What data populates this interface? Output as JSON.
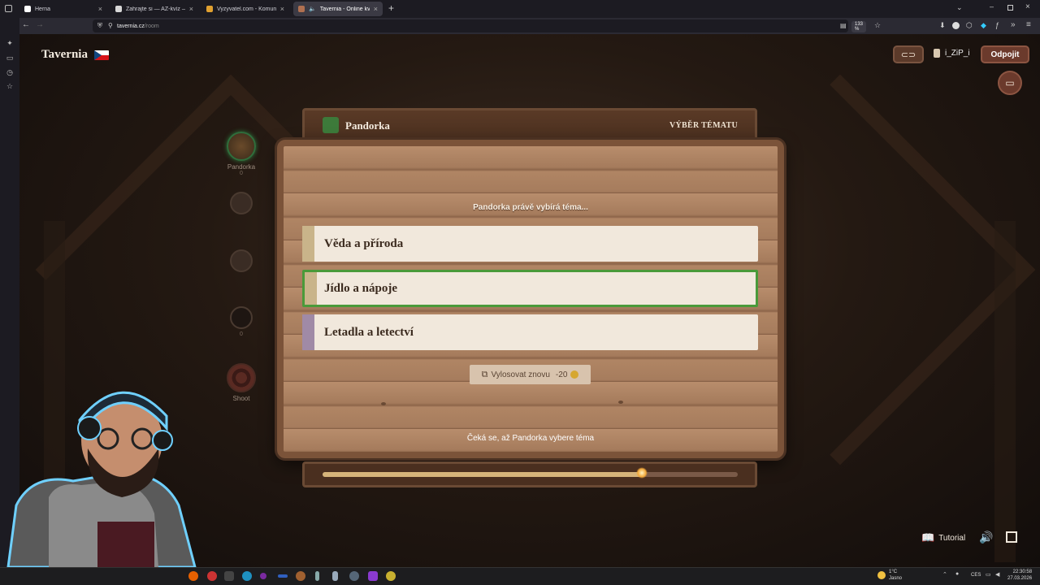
{
  "browser": {
    "tabs": [
      {
        "title": "Herna",
        "active": false
      },
      {
        "title": "Zahrajte si — AZ-kvíz — Český",
        "active": false
      },
      {
        "title": "Vyzyvatel.com - Komunitní věc",
        "active": false
      },
      {
        "title": "Tavernia - Online kvízová h",
        "active": true
      }
    ],
    "url_domain": "tavernia.cz",
    "url_path": "/room",
    "zoom": "133 %"
  },
  "header": {
    "brand": "Tavernia",
    "username": "i_ZiP_i",
    "disconnect_label": "Odpojit"
  },
  "players": [
    {
      "name": "Pandorka",
      "score": "0",
      "active": true
    },
    {
      "name": "",
      "score": "",
      "active": false
    },
    {
      "name": "",
      "score": "",
      "active": false
    },
    {
      "name": "",
      "score": "0",
      "active": false
    },
    {
      "name": "Shoot",
      "score": "",
      "active": false
    }
  ],
  "panel": {
    "player_name": "Pandorka",
    "mode_label": "VÝBĚR TÉMATU",
    "status_text": "Pandorka právě vybírá téma...",
    "topics": [
      {
        "label": "Věda a příroda",
        "stripe_color": "#c9b48a",
        "selected": false
      },
      {
        "label": "Jídlo a nápoje",
        "stripe_color": "#c9b48a",
        "selected": true
      },
      {
        "label": "Letadla a letectví",
        "stripe_color": "#a08aa6",
        "selected": false
      }
    ],
    "reroll_label": "Vylosovat znovu",
    "reroll_cost": "-20",
    "wait_text": "Čeká se, až Pandorka vybere téma",
    "timer_progress": 0.77
  },
  "footer": {
    "tutorial_label": "Tutorial"
  },
  "taskbar": {
    "weather_temp": "1°C",
    "weather_desc": "Jasno",
    "lang": "CES",
    "time": "22:30:58",
    "date": "27.03.2026"
  },
  "colors": {
    "accent_green": "#4a9a3a",
    "button_brown": "#6b3a2c",
    "card_bg": "#f1e8dc"
  }
}
